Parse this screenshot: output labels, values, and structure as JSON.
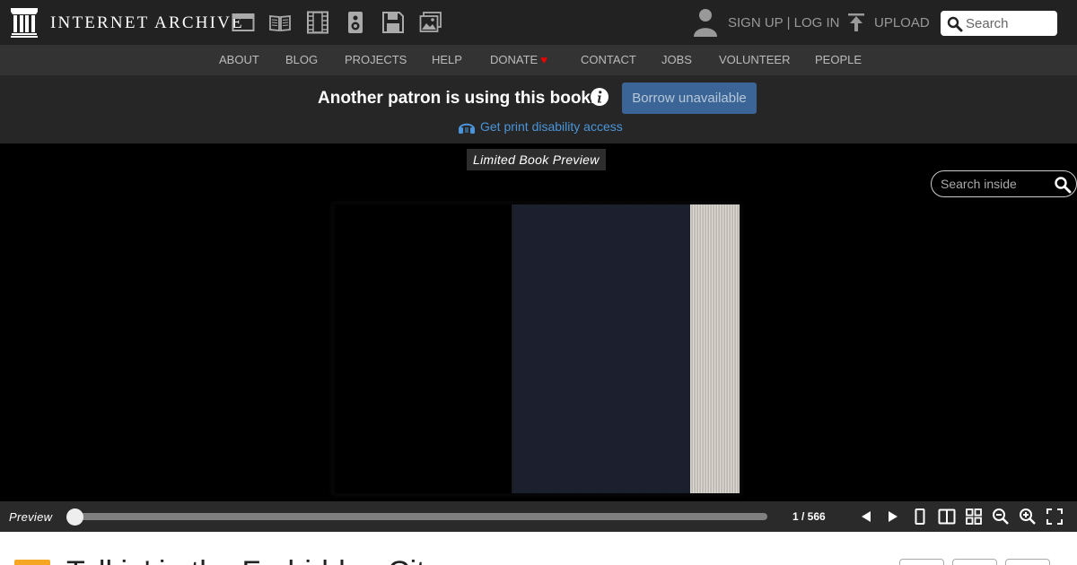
{
  "header": {
    "brand": "INTERNET ARCHIVE",
    "media_icons": [
      "web-icon",
      "texts-icon",
      "video-icon",
      "audio-icon",
      "software-icon",
      "images-icon"
    ],
    "signup_label": "SIGN UP | LOG IN",
    "upload_label": "UPLOAD",
    "search_placeholder": "Search"
  },
  "nav": {
    "items": [
      "ABOUT",
      "BLOG",
      "PROJECTS",
      "HELP",
      "DONATE",
      "CONTACT",
      "JOBS",
      "VOLUNTEER",
      "PEOPLE"
    ]
  },
  "borrow": {
    "message": "Another patron is using this book.",
    "button_label": "Borrow unavailable",
    "access_link": "Get print disability access"
  },
  "reader": {
    "badge": "Limited Book Preview",
    "search_placeholder": "Search inside"
  },
  "controls": {
    "preview_label": "Preview",
    "page_indicator": "1 / 566",
    "progress_fraction": 0.0
  },
  "item": {
    "title": "Talkin' in the Forbidden City"
  },
  "colors": {
    "header_bg": "#222222",
    "nav_bg": "#333333",
    "accent_link": "#4a95d9",
    "borrow_button": "#3a6596",
    "donate_heart": "#ee0000"
  }
}
